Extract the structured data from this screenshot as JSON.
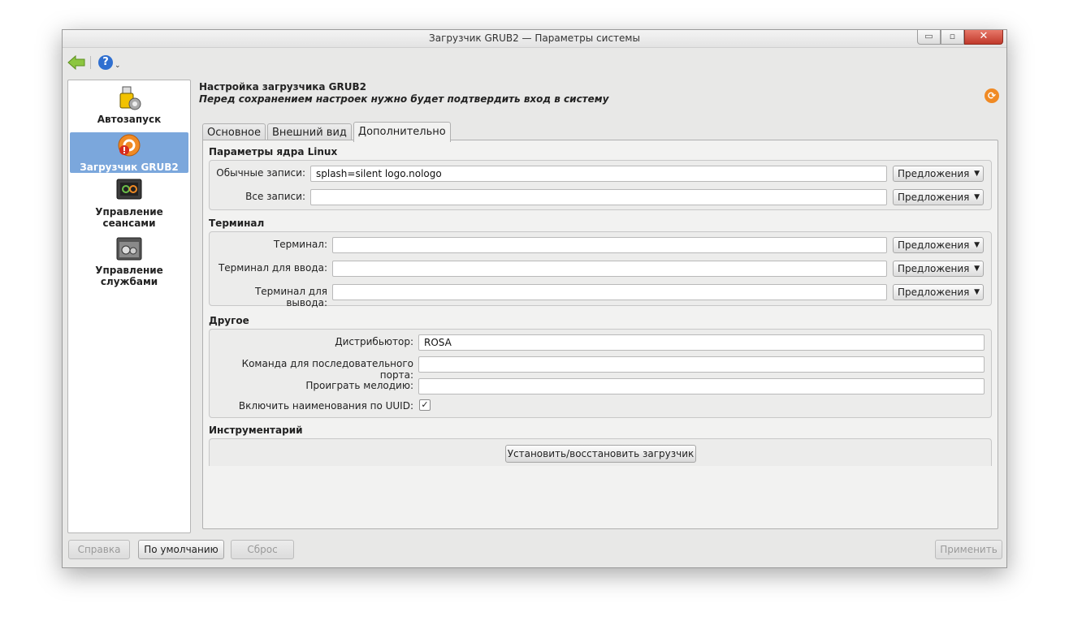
{
  "window": {
    "title": "Загрузчик GRUB2 — Параметры системы",
    "minimize_glyph": "▭",
    "maximize_glyph": "▫",
    "close_glyph": "✕"
  },
  "toolbar": {
    "help_glyph": "?",
    "help_arrow": "⌄"
  },
  "sidebar": {
    "items": [
      {
        "label": "Автозапуск",
        "icon": "usb-drive-gear-icon"
      },
      {
        "label": "Загрузчик GRUB2",
        "icon": "grub-boot-icon",
        "active": true
      },
      {
        "label": "Управление сеансами",
        "icon": "session-power-icon"
      },
      {
        "label": "Управление службами",
        "icon": "services-gears-icon"
      }
    ]
  },
  "header": {
    "title": "Настройка загрузчика GRUB2",
    "subtitle": "Перед сохранением настроек нужно будет подтвердить вход в систему"
  },
  "tabs": [
    {
      "label": "Основное"
    },
    {
      "label": "Внешний вид"
    },
    {
      "label": "Дополнительно",
      "active": true
    }
  ],
  "kernel": {
    "title": "Параметры ядра Linux",
    "normal_label": "Обычные записи:",
    "normal_value": "splash=silent logo.nologo",
    "all_label": "Все записи:",
    "all_value": ""
  },
  "terminal": {
    "title": "Терминал",
    "terminal_label": "Терминал:",
    "input_label": "Терминал для ввода:",
    "output_label": "Терминал для вывода:"
  },
  "suggestions_label": "Предложения",
  "other": {
    "title": "Другое",
    "distributor_label": "Дистрибьютор:",
    "distributor_value": "ROSA",
    "serial_label": "Команда для последовательного порта:",
    "serial_value": "",
    "tune_label": "Проиграть мелодию:",
    "tune_value": "",
    "uuid_label": "Включить наименования по UUID:",
    "uuid_checked": true,
    "check_glyph": "✓"
  },
  "tools": {
    "title": "Инструментарий",
    "install_button": "Установить/восстановить загрузчик"
  },
  "footer": {
    "help_button": "Справка",
    "defaults_button": "По умолчанию",
    "reset_button": "Сброс",
    "apply_button": "Применить"
  },
  "colors": {
    "accent": "#7ba7dc",
    "close": "#c0392b",
    "back_arrow": "#8cc63f",
    "grub_orange": "#f08a24"
  }
}
